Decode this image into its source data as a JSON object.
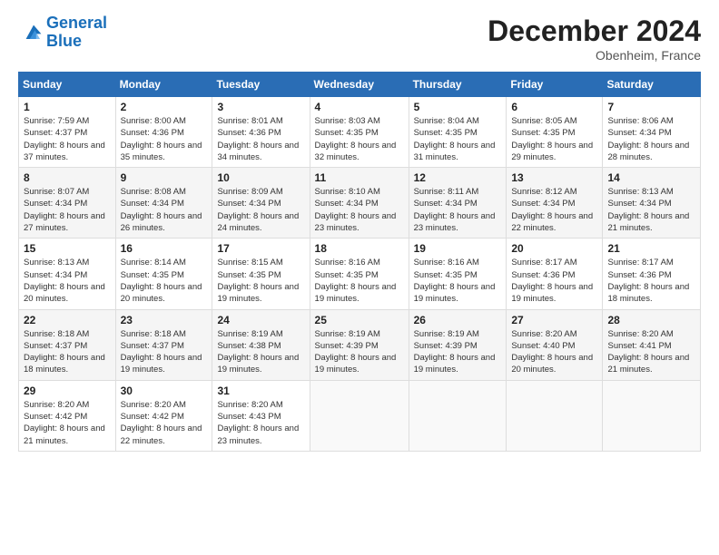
{
  "logo": {
    "line1": "General",
    "line2": "Blue"
  },
  "header": {
    "month": "December 2024",
    "location": "Obenheim, France"
  },
  "weekdays": [
    "Sunday",
    "Monday",
    "Tuesday",
    "Wednesday",
    "Thursday",
    "Friday",
    "Saturday"
  ],
  "weeks": [
    [
      {
        "day": "1",
        "sunrise": "7:59 AM",
        "sunset": "4:37 PM",
        "daylight": "8 hours and 37 minutes."
      },
      {
        "day": "2",
        "sunrise": "8:00 AM",
        "sunset": "4:36 PM",
        "daylight": "8 hours and 35 minutes."
      },
      {
        "day": "3",
        "sunrise": "8:01 AM",
        "sunset": "4:36 PM",
        "daylight": "8 hours and 34 minutes."
      },
      {
        "day": "4",
        "sunrise": "8:03 AM",
        "sunset": "4:35 PM",
        "daylight": "8 hours and 32 minutes."
      },
      {
        "day": "5",
        "sunrise": "8:04 AM",
        "sunset": "4:35 PM",
        "daylight": "8 hours and 31 minutes."
      },
      {
        "day": "6",
        "sunrise": "8:05 AM",
        "sunset": "4:35 PM",
        "daylight": "8 hours and 29 minutes."
      },
      {
        "day": "7",
        "sunrise": "8:06 AM",
        "sunset": "4:34 PM",
        "daylight": "8 hours and 28 minutes."
      }
    ],
    [
      {
        "day": "8",
        "sunrise": "8:07 AM",
        "sunset": "4:34 PM",
        "daylight": "8 hours and 27 minutes."
      },
      {
        "day": "9",
        "sunrise": "8:08 AM",
        "sunset": "4:34 PM",
        "daylight": "8 hours and 26 minutes."
      },
      {
        "day": "10",
        "sunrise": "8:09 AM",
        "sunset": "4:34 PM",
        "daylight": "8 hours and 24 minutes."
      },
      {
        "day": "11",
        "sunrise": "8:10 AM",
        "sunset": "4:34 PM",
        "daylight": "8 hours and 23 minutes."
      },
      {
        "day": "12",
        "sunrise": "8:11 AM",
        "sunset": "4:34 PM",
        "daylight": "8 hours and 23 minutes."
      },
      {
        "day": "13",
        "sunrise": "8:12 AM",
        "sunset": "4:34 PM",
        "daylight": "8 hours and 22 minutes."
      },
      {
        "day": "14",
        "sunrise": "8:13 AM",
        "sunset": "4:34 PM",
        "daylight": "8 hours and 21 minutes."
      }
    ],
    [
      {
        "day": "15",
        "sunrise": "8:13 AM",
        "sunset": "4:34 PM",
        "daylight": "8 hours and 20 minutes."
      },
      {
        "day": "16",
        "sunrise": "8:14 AM",
        "sunset": "4:35 PM",
        "daylight": "8 hours and 20 minutes."
      },
      {
        "day": "17",
        "sunrise": "8:15 AM",
        "sunset": "4:35 PM",
        "daylight": "8 hours and 19 minutes."
      },
      {
        "day": "18",
        "sunrise": "8:16 AM",
        "sunset": "4:35 PM",
        "daylight": "8 hours and 19 minutes."
      },
      {
        "day": "19",
        "sunrise": "8:16 AM",
        "sunset": "4:35 PM",
        "daylight": "8 hours and 19 minutes."
      },
      {
        "day": "20",
        "sunrise": "8:17 AM",
        "sunset": "4:36 PM",
        "daylight": "8 hours and 19 minutes."
      },
      {
        "day": "21",
        "sunrise": "8:17 AM",
        "sunset": "4:36 PM",
        "daylight": "8 hours and 18 minutes."
      }
    ],
    [
      {
        "day": "22",
        "sunrise": "8:18 AM",
        "sunset": "4:37 PM",
        "daylight": "8 hours and 18 minutes."
      },
      {
        "day": "23",
        "sunrise": "8:18 AM",
        "sunset": "4:37 PM",
        "daylight": "8 hours and 19 minutes."
      },
      {
        "day": "24",
        "sunrise": "8:19 AM",
        "sunset": "4:38 PM",
        "daylight": "8 hours and 19 minutes."
      },
      {
        "day": "25",
        "sunrise": "8:19 AM",
        "sunset": "4:39 PM",
        "daylight": "8 hours and 19 minutes."
      },
      {
        "day": "26",
        "sunrise": "8:19 AM",
        "sunset": "4:39 PM",
        "daylight": "8 hours and 19 minutes."
      },
      {
        "day": "27",
        "sunrise": "8:20 AM",
        "sunset": "4:40 PM",
        "daylight": "8 hours and 20 minutes."
      },
      {
        "day": "28",
        "sunrise": "8:20 AM",
        "sunset": "4:41 PM",
        "daylight": "8 hours and 21 minutes."
      }
    ],
    [
      {
        "day": "29",
        "sunrise": "8:20 AM",
        "sunset": "4:42 PM",
        "daylight": "8 hours and 21 minutes."
      },
      {
        "day": "30",
        "sunrise": "8:20 AM",
        "sunset": "4:42 PM",
        "daylight": "8 hours and 22 minutes."
      },
      {
        "day": "31",
        "sunrise": "8:20 AM",
        "sunset": "4:43 PM",
        "daylight": "8 hours and 23 minutes."
      },
      null,
      null,
      null,
      null
    ]
  ]
}
